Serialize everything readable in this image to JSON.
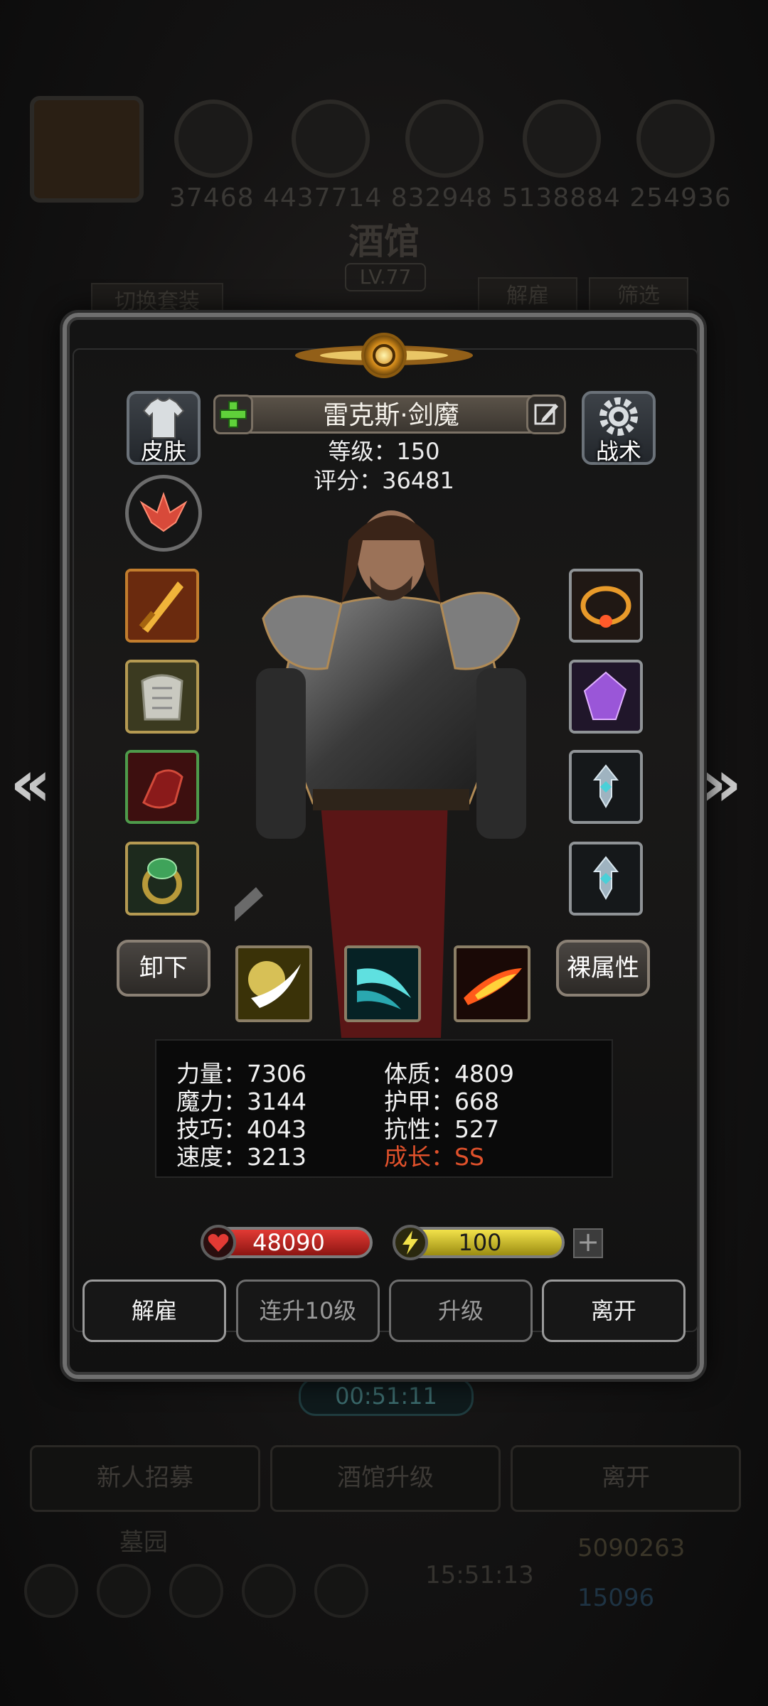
{
  "background": {
    "resource_values": "37468 4437714 832948 5138884 254936",
    "tavern_title": "酒馆",
    "tavern_level": "LV.77",
    "tab_switch_outfit": "切换套装",
    "tab_dismiss": "解雇",
    "tab_filter": "筛选",
    "timer": "00:51:11",
    "btn_recruit": "新人招募",
    "btn_tavern_upgrade": "酒馆升级",
    "btn_leave": "离开",
    "graveyard": "墓园",
    "clock": "15:51:13",
    "gold": "5090263",
    "gems": "15096"
  },
  "hero": {
    "name": "雷克斯·剑魔",
    "level_label": "等级：150",
    "score_label": "评分：36481"
  },
  "side_buttons": {
    "skin": "皮肤",
    "tactics": "战术",
    "unequip": "卸下",
    "base_attributes": "裸属性"
  },
  "stats": {
    "strength": "力量：7306",
    "magic": "魔力：3144",
    "skill": "技巧：4043",
    "speed": "速度：3213",
    "constitution": "体质：4809",
    "armor": "护甲：668",
    "resistance": "抗性：527",
    "growth": "成长：SS"
  },
  "bars": {
    "hp": "48090",
    "energy": "100",
    "add": "+"
  },
  "actions": {
    "dismiss": "解雇",
    "level10": "连升10级",
    "upgrade": "升级",
    "leave": "离开"
  },
  "colors": {
    "growth": "#e0512b",
    "hp": "#e23a34",
    "energy": "#f2e24a"
  }
}
